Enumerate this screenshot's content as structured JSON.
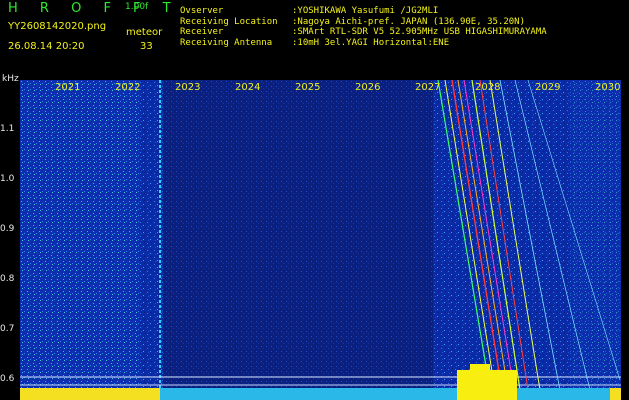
{
  "header": {
    "title": "H R O F F T",
    "version": "1.00f",
    "filename": "YY2608142020.png",
    "meteor_label": "meteor",
    "datetime": "26.08.14 20:20",
    "meteor_count": "33"
  },
  "station_info": [
    {
      "key": "Ovserver",
      "value": ":YOSHIKAWA Yasufumi /JG2MLI"
    },
    {
      "key": "Receiving Location",
      "value": ":Nagoya Aichi-pref. JAPAN (136.90E, 35.20N)"
    },
    {
      "key": "Receiver",
      "value": ":SMArt RTL-SDR V5 52.905MHz USB HIGASHIMURAYAMA"
    },
    {
      "key": "Receiving Antenna",
      "value": ":10mH 3el.YAGI Horizontal:ENE"
    }
  ],
  "axis": {
    "unit": "kHz",
    "freq_labels": [
      "1.1",
      "1.0",
      "0.9",
      "0.8",
      "0.7",
      "0.6"
    ],
    "minute_labels": [
      "2021",
      "2022",
      "2023",
      "2024",
      "2025",
      "2026",
      "2027",
      "2028",
      "2029",
      "2030"
    ]
  },
  "colors": {
    "background": "#0a2a9a",
    "label_yellow": "#f2f21a",
    "label_green": "#2fe82f",
    "label_white": "#e8e8e8"
  }
}
